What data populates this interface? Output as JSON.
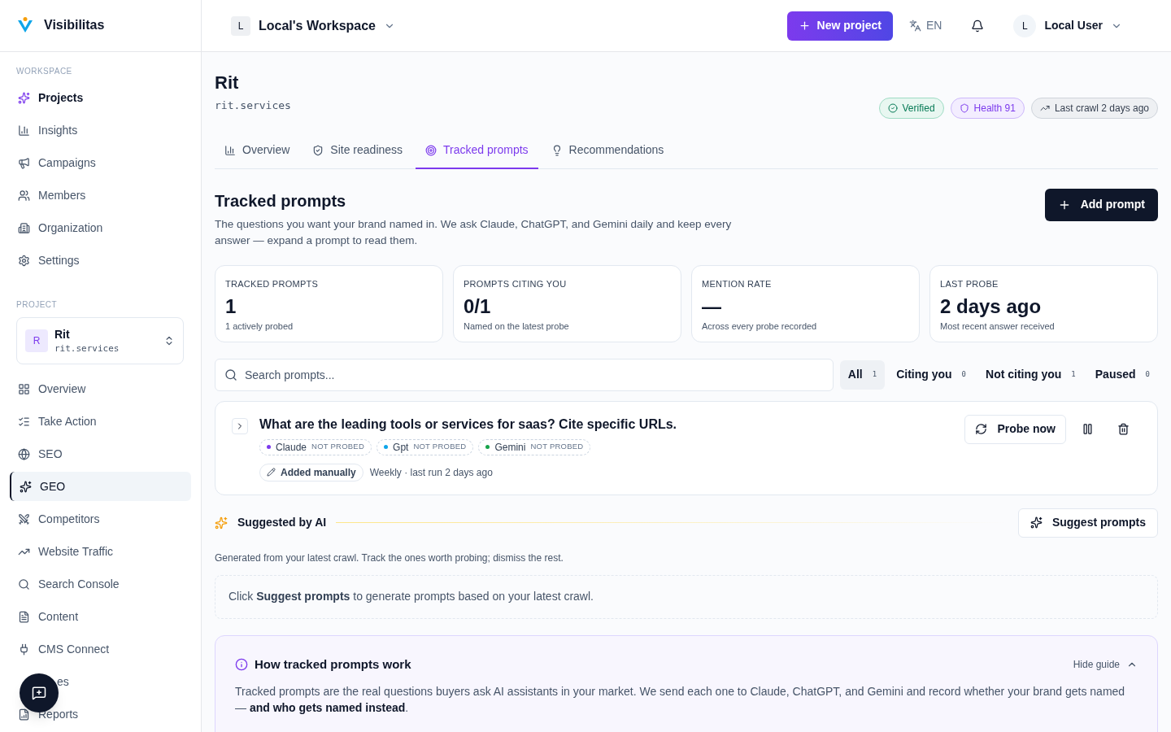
{
  "brand": {
    "name": "Visibilitas"
  },
  "workspace": {
    "initial": "L",
    "name": "Local's Workspace"
  },
  "header": {
    "new_project": "New project",
    "language": "EN",
    "user": {
      "initial": "L",
      "name": "Local User"
    }
  },
  "sidebar": {
    "sections": [
      {
        "title": "WORKSPACE",
        "items": [
          {
            "label": "Projects",
            "selected": true
          },
          {
            "label": "Insights",
            "selected": false
          },
          {
            "label": "Campaigns",
            "selected": false
          },
          {
            "label": "Members",
            "selected": false
          },
          {
            "label": "Organization",
            "selected": false
          },
          {
            "label": "Settings",
            "selected": false
          }
        ]
      },
      {
        "title": "PROJECT",
        "items": [
          {
            "label": "Overview",
            "selected": false
          },
          {
            "label": "Take Action",
            "selected": false
          },
          {
            "label": "SEO",
            "selected": false
          },
          {
            "label": "GEO",
            "selected": true
          },
          {
            "label": "Competitors",
            "selected": false
          },
          {
            "label": "Website Traffic",
            "selected": false
          },
          {
            "label": "Search Console",
            "selected": false
          },
          {
            "label": "Content",
            "selected": false
          },
          {
            "label": "CMS Connect",
            "selected": false
          },
          {
            "label": "es",
            "selected": false,
            "covered": true
          },
          {
            "label": "Reports",
            "selected": false
          }
        ]
      }
    ],
    "project": {
      "initial": "R",
      "name": "Rit",
      "domain": "rit.services"
    }
  },
  "page": {
    "title": "Rit",
    "domain": "rit.services",
    "badges": [
      {
        "kind": "verified",
        "label": "Verified"
      },
      {
        "kind": "health",
        "label": "Health 91"
      },
      {
        "kind": "crawl",
        "label": "Last crawl 2 days ago"
      }
    ],
    "tabs": [
      {
        "label": "Overview",
        "selected": false
      },
      {
        "label": "Site readiness",
        "selected": false
      },
      {
        "label": "Tracked prompts",
        "selected": true
      },
      {
        "label": "Recommendations",
        "selected": false
      }
    ]
  },
  "section": {
    "title": "Tracked prompts",
    "description": "The questions you want your brand named in. We ask Claude, ChatGPT, and Gemini daily and keep every answer — expand a prompt to read them.",
    "add_button": "Add prompt"
  },
  "stats": [
    {
      "label": "TRACKED PROMPTS",
      "value": "1",
      "note": "1 actively probed"
    },
    {
      "label": "PROMPTS CITING YOU",
      "value": "0/1",
      "note": "Named on the latest probe"
    },
    {
      "label": "MENTION RATE",
      "value": "—",
      "note": "Across every probe recorded"
    },
    {
      "label": "LAST PROBE",
      "value": "2 days ago",
      "note": "Most recent answer received"
    }
  ],
  "search": {
    "placeholder": "Search prompts..."
  },
  "filters": [
    {
      "label": "All",
      "count": "1",
      "selected": true
    },
    {
      "label": "Citing you",
      "count": "0",
      "selected": false
    },
    {
      "label": "Not citing you",
      "count": "1",
      "selected": false
    },
    {
      "label": "Paused",
      "count": "0",
      "selected": false
    }
  ],
  "prompts": [
    {
      "question": "What are the leading tools or services for saas? Cite specific URLs.",
      "expanded": false,
      "models": [
        {
          "name": "Claude",
          "status": "NOT PROBED",
          "color": "#7c3aed"
        },
        {
          "name": "Gpt",
          "status": "NOT PROBED",
          "color": "#0ea5e9"
        },
        {
          "name": "Gemini",
          "status": "NOT PROBED",
          "color": "#16a34a"
        }
      ],
      "source": "Added manually",
      "schedule": "Weekly · last run 2 days ago",
      "probe_button": "Probe now"
    }
  ],
  "suggested": {
    "title": "Suggested by AI",
    "button": "Suggest prompts",
    "note": "Generated from your latest crawl. Track the ones worth probing; dismiss the rest.",
    "empty": "Click **Suggest prompts** to generate prompts based on your latest crawl."
  },
  "guide": {
    "title": "How tracked prompts work",
    "toggle": "Hide guide",
    "expanded": true,
    "body": "Tracked prompts are the real questions buyers ask AI assistants in your market. We send each one to Claude, ChatGPT, and Gemini and record whether your brand gets named — **and who gets named instead**."
  }
}
